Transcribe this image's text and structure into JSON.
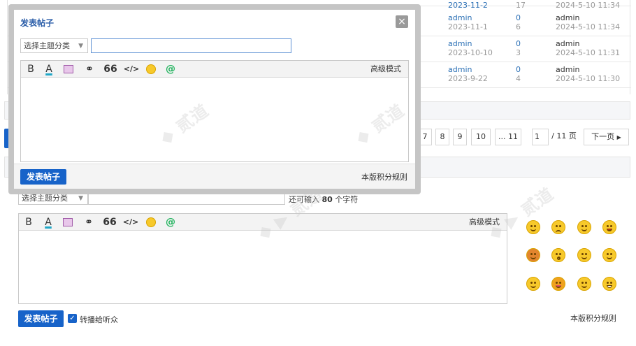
{
  "threads": [
    {
      "author": "admin",
      "date": "2023-11-2",
      "replies": "",
      "views": "17",
      "last_user": "",
      "last_time": "2024-5-10 11:34"
    },
    {
      "author": "admin",
      "date": "2023-11-1",
      "replies": "0",
      "views": "6",
      "last_user": "admin",
      "last_time": "2024-5-10 11:34"
    },
    {
      "author": "admin",
      "date": "2023-10-10",
      "replies": "0",
      "views": "3",
      "last_user": "admin",
      "last_time": "2024-5-10 11:31"
    },
    {
      "author": "admin",
      "date": "2023-9-22",
      "replies": "0",
      "views": "4",
      "last_user": "admin",
      "last_time": "2024-5-10 11:30"
    }
  ],
  "pager": {
    "pages": [
      "7",
      "8",
      "9",
      "10"
    ],
    "ellipsis": "... 11",
    "current": "1",
    "total": "/ 11 页",
    "next": "下一页"
  },
  "popup": {
    "title": "发表帖子",
    "close": "×",
    "category": "选择主题分类",
    "advanced": "高级模式",
    "submit": "发表帖子",
    "rules": "本版积分规则"
  },
  "editor": {
    "category": "选择主题分类",
    "remaining_prefix": "还可输入",
    "remaining_count": "80",
    "remaining_suffix": "个字符",
    "advanced": "高级模式",
    "submit": "发表帖子",
    "broadcast": "转播给听众",
    "rules": "本版积分规则"
  },
  "toolbar_icons": [
    "bold-icon",
    "font-color-icon",
    "image-icon",
    "link-icon",
    "quote-icon",
    "code-icon",
    "emoji-icon",
    "at-icon"
  ],
  "toolbar_glyphs": {
    "bold": "B",
    "color": "A",
    "quote": "66",
    "code": "</>",
    "at": "@"
  },
  "watermark_text": "DISCUZ!应用中心|贰道 addon.dismall.com",
  "colors": {
    "primary": "#1763c9",
    "link": "#2a6fb5"
  }
}
